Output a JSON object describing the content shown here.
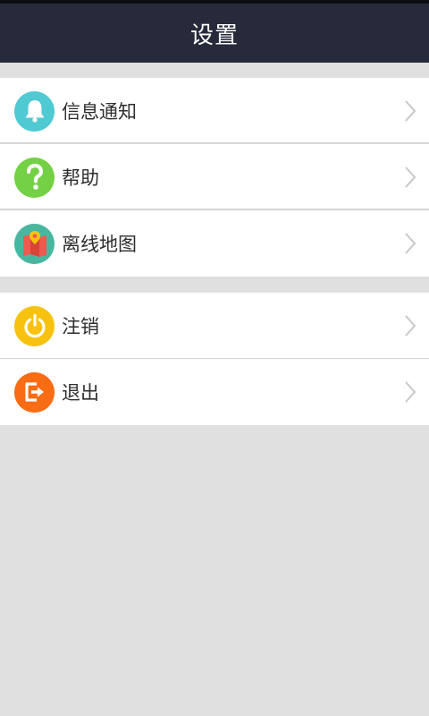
{
  "header": {
    "title": "设置"
  },
  "colors": {
    "header_bg": "#262a3b",
    "notification": "#4fc9d2",
    "help": "#74d044",
    "offline_map": "#49b7a0",
    "logout": "#f7c20f",
    "exit": "#f86c13"
  },
  "groups": [
    {
      "items": [
        {
          "label": "信息通知",
          "icon": "bell-icon"
        },
        {
          "label": "帮助",
          "icon": "question-mark-icon"
        },
        {
          "label": "离线地图",
          "icon": "map-pin-icon"
        }
      ]
    },
    {
      "items": [
        {
          "label": "注销",
          "icon": "power-icon"
        },
        {
          "label": "退出",
          "icon": "exit-icon"
        }
      ]
    }
  ]
}
